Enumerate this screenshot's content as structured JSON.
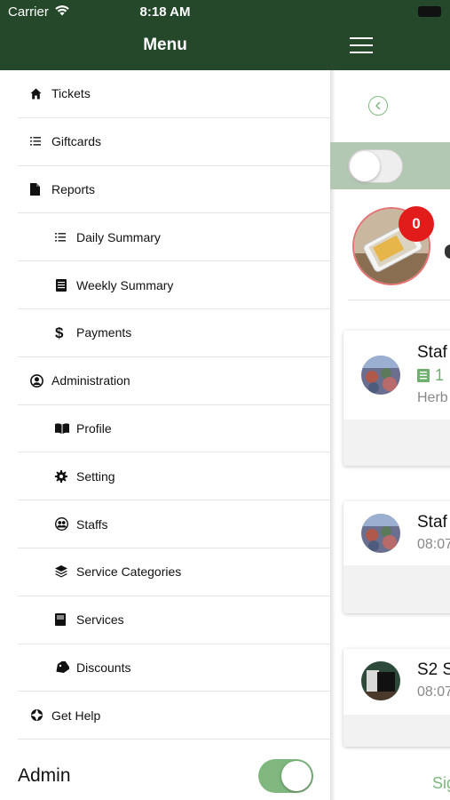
{
  "status_bar": {
    "carrier": "Carrier",
    "time": "8:18 AM"
  },
  "drawer": {
    "title": "Menu",
    "items": [
      {
        "label": "Tickets",
        "icon": "home-icon",
        "level": "top"
      },
      {
        "label": "Giftcards",
        "icon": "list-icon",
        "level": "top"
      },
      {
        "label": "Reports",
        "icon": "document-icon",
        "level": "top"
      },
      {
        "label": "Daily Summary",
        "icon": "list-icon",
        "level": "sub"
      },
      {
        "label": "Weekly Summary",
        "icon": "book-icon",
        "level": "sub"
      },
      {
        "label": "Payments",
        "icon": "dollar-icon",
        "level": "sub"
      },
      {
        "label": "Administration",
        "icon": "user-circle-icon",
        "level": "top"
      },
      {
        "label": "Profile",
        "icon": "open-book-icon",
        "level": "sub"
      },
      {
        "label": "Setting",
        "icon": "gear-icon",
        "level": "sub"
      },
      {
        "label": "Staffs",
        "icon": "users-icon",
        "level": "sub"
      },
      {
        "label": "Service Categories",
        "icon": "layers-icon",
        "level": "sub"
      },
      {
        "label": "Services",
        "icon": "book-icon",
        "level": "sub"
      },
      {
        "label": "Discounts",
        "icon": "tag-icon",
        "level": "sub"
      },
      {
        "label": "Get Help",
        "icon": "lifebuoy-icon",
        "level": "top"
      }
    ],
    "admin_label": "Admin",
    "admin_toggle_on": true
  },
  "main": {
    "badge_count": "0",
    "cards": [
      {
        "name": "Staf",
        "count": "1",
        "sub": "Herb"
      },
      {
        "name": "Staf",
        "sub": "08:07"
      },
      {
        "name": "S2 S",
        "sub": "08:07"
      }
    ],
    "bottom_link": "Sig"
  },
  "colors": {
    "header_green": "#25482b",
    "accent_green": "#7fb77f",
    "badge_red": "#e21b1b",
    "band_green": "#b3c8b2"
  }
}
